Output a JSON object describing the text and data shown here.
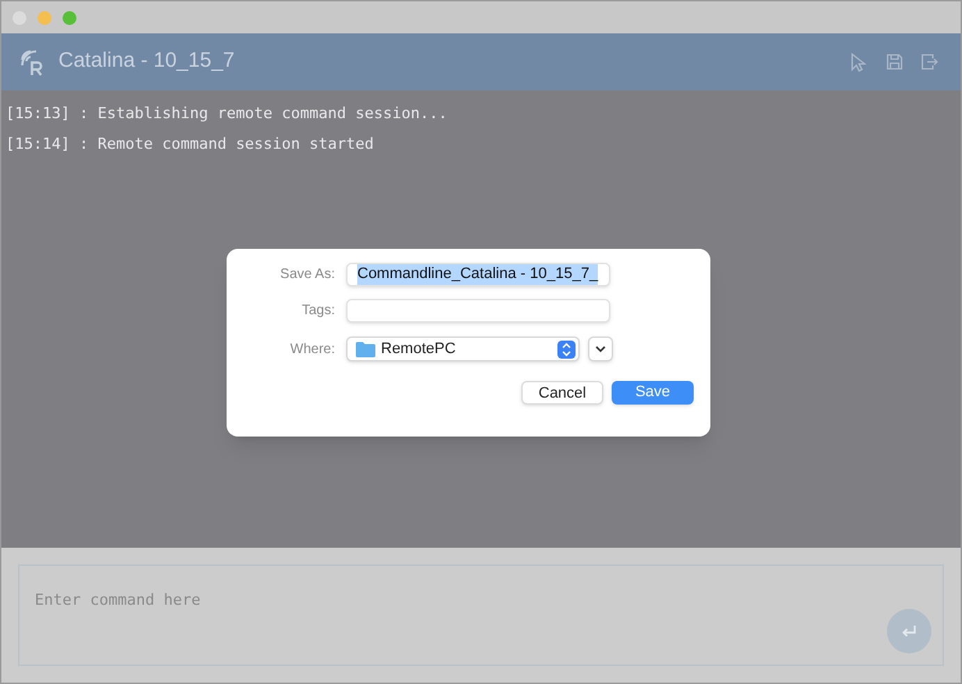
{
  "window": {
    "title": "Catalina - 10_15_7"
  },
  "log": [
    "[15:13] : Establishing remote command session...",
    "[15:14] : Remote command session started"
  ],
  "dialog": {
    "fields": [
      {
        "kind": "text",
        "label": "Save As:",
        "value": "Commandline_Catalina - 10_15_7_",
        "selected": true
      },
      {
        "kind": "text",
        "label": "Tags:"
      },
      {
        "kind": "popup",
        "label": "Where:",
        "value": "RemotePC"
      }
    ],
    "buttons": [
      {
        "label": "Cancel",
        "default": false
      },
      {
        "label": "Save",
        "default": true
      }
    ]
  },
  "command": {
    "placeholder": "Enter command here"
  }
}
